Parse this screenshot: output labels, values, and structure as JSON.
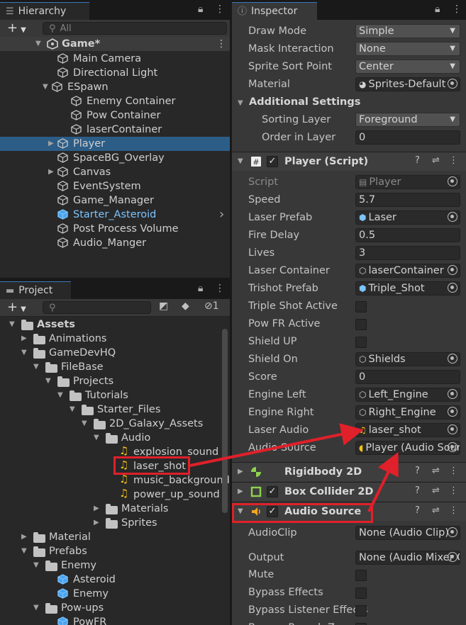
{
  "hierarchy": {
    "tab": "Hierarchy",
    "search_placeholder": "All",
    "scene": "Game*",
    "items": [
      {
        "label": "Main Camera"
      },
      {
        "label": "Directional Light"
      },
      {
        "label": "ESpawn"
      },
      {
        "label": "Enemy Container"
      },
      {
        "label": "Pow Container"
      },
      {
        "label": "laserContainer"
      },
      {
        "label": "Player"
      },
      {
        "label": "SpaceBG_Overlay"
      },
      {
        "label": "Canvas"
      },
      {
        "label": "EventSystem"
      },
      {
        "label": "Game_Manager"
      },
      {
        "label": "Starter_Asteroid"
      },
      {
        "label": "Post Process Volume"
      },
      {
        "label": "Audio_Manger"
      }
    ]
  },
  "project": {
    "tab": "Project",
    "hidden_count": "1",
    "items": [
      {
        "label": "Assets"
      },
      {
        "label": "Animations"
      },
      {
        "label": "GameDevHQ"
      },
      {
        "label": "FileBase"
      },
      {
        "label": "Projects"
      },
      {
        "label": "Tutorials"
      },
      {
        "label": "Starter_Files"
      },
      {
        "label": "2D_Galaxy_Assets"
      },
      {
        "label": "Audio"
      },
      {
        "label": "explosion_sound"
      },
      {
        "label": "laser_shot"
      },
      {
        "label": "music_background"
      },
      {
        "label": "power_up_sound"
      },
      {
        "label": "Materials"
      },
      {
        "label": "Sprites"
      },
      {
        "label": "Material"
      },
      {
        "label": "Prefabs"
      },
      {
        "label": "Enemy"
      },
      {
        "label": "Asteroid"
      },
      {
        "label": "Enemy"
      },
      {
        "label": "Pow-ups"
      },
      {
        "label": "PowFR"
      }
    ]
  },
  "inspector": {
    "tab": "Inspector",
    "sprite_rows": [
      {
        "label": "Draw Mode",
        "value": "Simple"
      },
      {
        "label": "Mask Interaction",
        "value": "None"
      },
      {
        "label": "Sprite Sort Point",
        "value": "Center"
      },
      {
        "label": "Material",
        "value": "Sprites-Default"
      }
    ],
    "additional_settings": "Additional Settings",
    "sorting_layer": {
      "label": "Sorting Layer",
      "value": "Foreground"
    },
    "order_in_layer": {
      "label": "Order in Layer",
      "value": "0"
    },
    "components": {
      "player_script": "Player (Script)",
      "rigidbody": "Rigidbody 2D",
      "box_collider": "Box Collider 2D",
      "audio_source": "Audio Source"
    },
    "player_fields": [
      {
        "label": "Script",
        "value": "Player"
      },
      {
        "label": "Speed",
        "value": "5.7"
      },
      {
        "label": "Laser Prefab",
        "value": "Laser"
      },
      {
        "label": "Fire Delay",
        "value": "0.5"
      },
      {
        "label": "Lives",
        "value": "3"
      },
      {
        "label": "Laser Container",
        "value": "laserContainer"
      },
      {
        "label": "Trishot Prefab",
        "value": "Triple_Shot"
      },
      {
        "label": "Triple Shot Active",
        "value": ""
      },
      {
        "label": "Pow FR Active",
        "value": ""
      },
      {
        "label": "Shield UP",
        "value": ""
      },
      {
        "label": "Shield On",
        "value": "Shields"
      },
      {
        "label": "Score",
        "value": "0"
      },
      {
        "label": "Engine Left",
        "value": "Left_Engine"
      },
      {
        "label": "Engine Right",
        "value": "Right_Engine"
      },
      {
        "label": "Laser Audio",
        "value": "laser_shot"
      },
      {
        "label": "Audio Source",
        "value": "Player (Audio Source)"
      }
    ],
    "audio_fields": [
      {
        "label": "AudioClip",
        "value": "None (Audio Clip)"
      },
      {
        "label": "Output",
        "value": "None (Audio Mixer Group)"
      },
      {
        "label": "Mute",
        "value": ""
      },
      {
        "label": "Bypass Effects",
        "value": ""
      },
      {
        "label": "Bypass Listener Effects",
        "value": ""
      },
      {
        "label": "Bypass Reverb Zones",
        "value": ""
      }
    ]
  },
  "colors": {
    "selection": "#2c5d87",
    "annotation": "#e0202a",
    "prefab_blue": "#7cc4ff",
    "audio_yellow": "#f5c518"
  }
}
